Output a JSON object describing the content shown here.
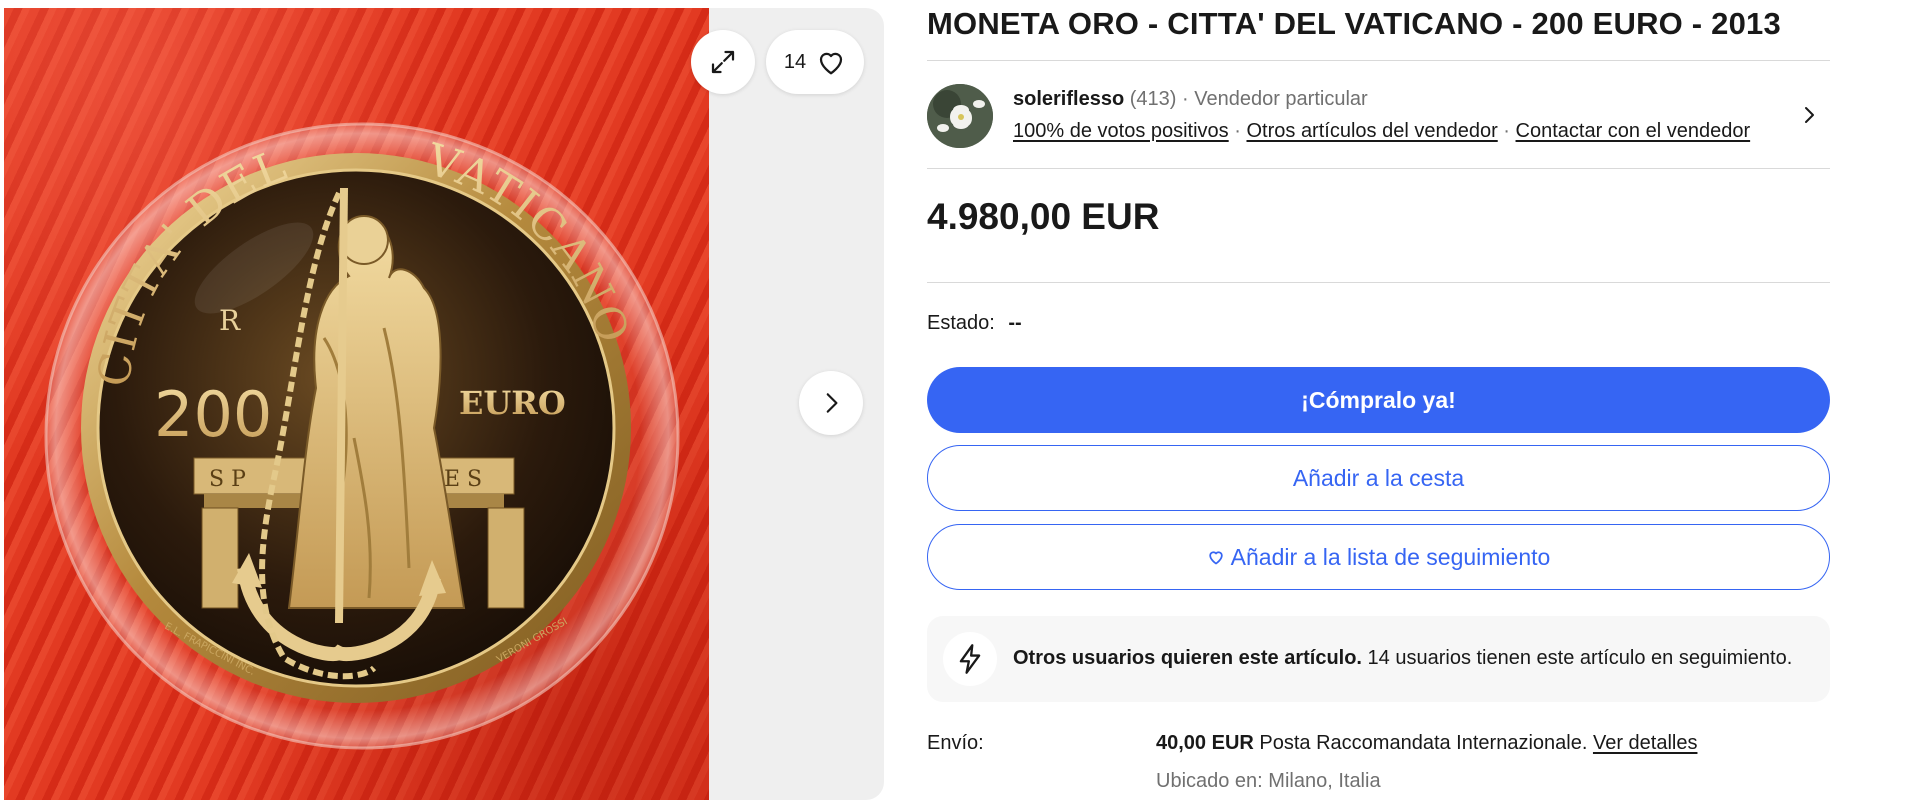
{
  "listing": {
    "title": "MONETA ORO - CITTA' DEL VATICANO - 200 EURO - 2013",
    "price": "4.980,00 EUR",
    "condition_label": "Estado:",
    "condition_value": "--"
  },
  "gallery": {
    "watch_count": "14",
    "expand_icon": "expand-icon",
    "heart_icon": "heart-icon",
    "next_icon": "chevron-right-icon",
    "coin_text": {
      "legend_left": "CITTA' DEL",
      "legend_right": "VATICANO",
      "mint_mark": "R",
      "value": "200",
      "unit": "EURO",
      "bench_left": "S P",
      "bench_right": "E S",
      "engraver_left": "E.L. FRAPICCINI INC.",
      "engraver_right": "VERONI GROSSI"
    }
  },
  "seller": {
    "name": "soleriflesso",
    "feedback_count": "(413)",
    "separator": "·",
    "type": "Vendedor particular",
    "positive": "100% de votos positivos",
    "other_items": "Otros artículos del vendedor",
    "contact": "Contactar con el vendedor"
  },
  "actions": {
    "buy_now": "¡Cómpralo ya!",
    "add_to_cart": "Añadir a la cesta",
    "add_to_watchlist": "Añadir a la lista de seguimiento"
  },
  "promo": {
    "bold": "Otros usuarios quieren este artículo.",
    "text": "14 usuarios tienen este artículo en seguimiento."
  },
  "shipping": {
    "label": "Envío:",
    "cost": "40,00 EUR",
    "service": "Posta Raccomandata Internazionale.",
    "details_link": "Ver detalles",
    "location": "Ubicado en: Milano, Italia"
  },
  "colors": {
    "accent": "#3665f3",
    "text": "#191919",
    "muted": "#707070"
  }
}
